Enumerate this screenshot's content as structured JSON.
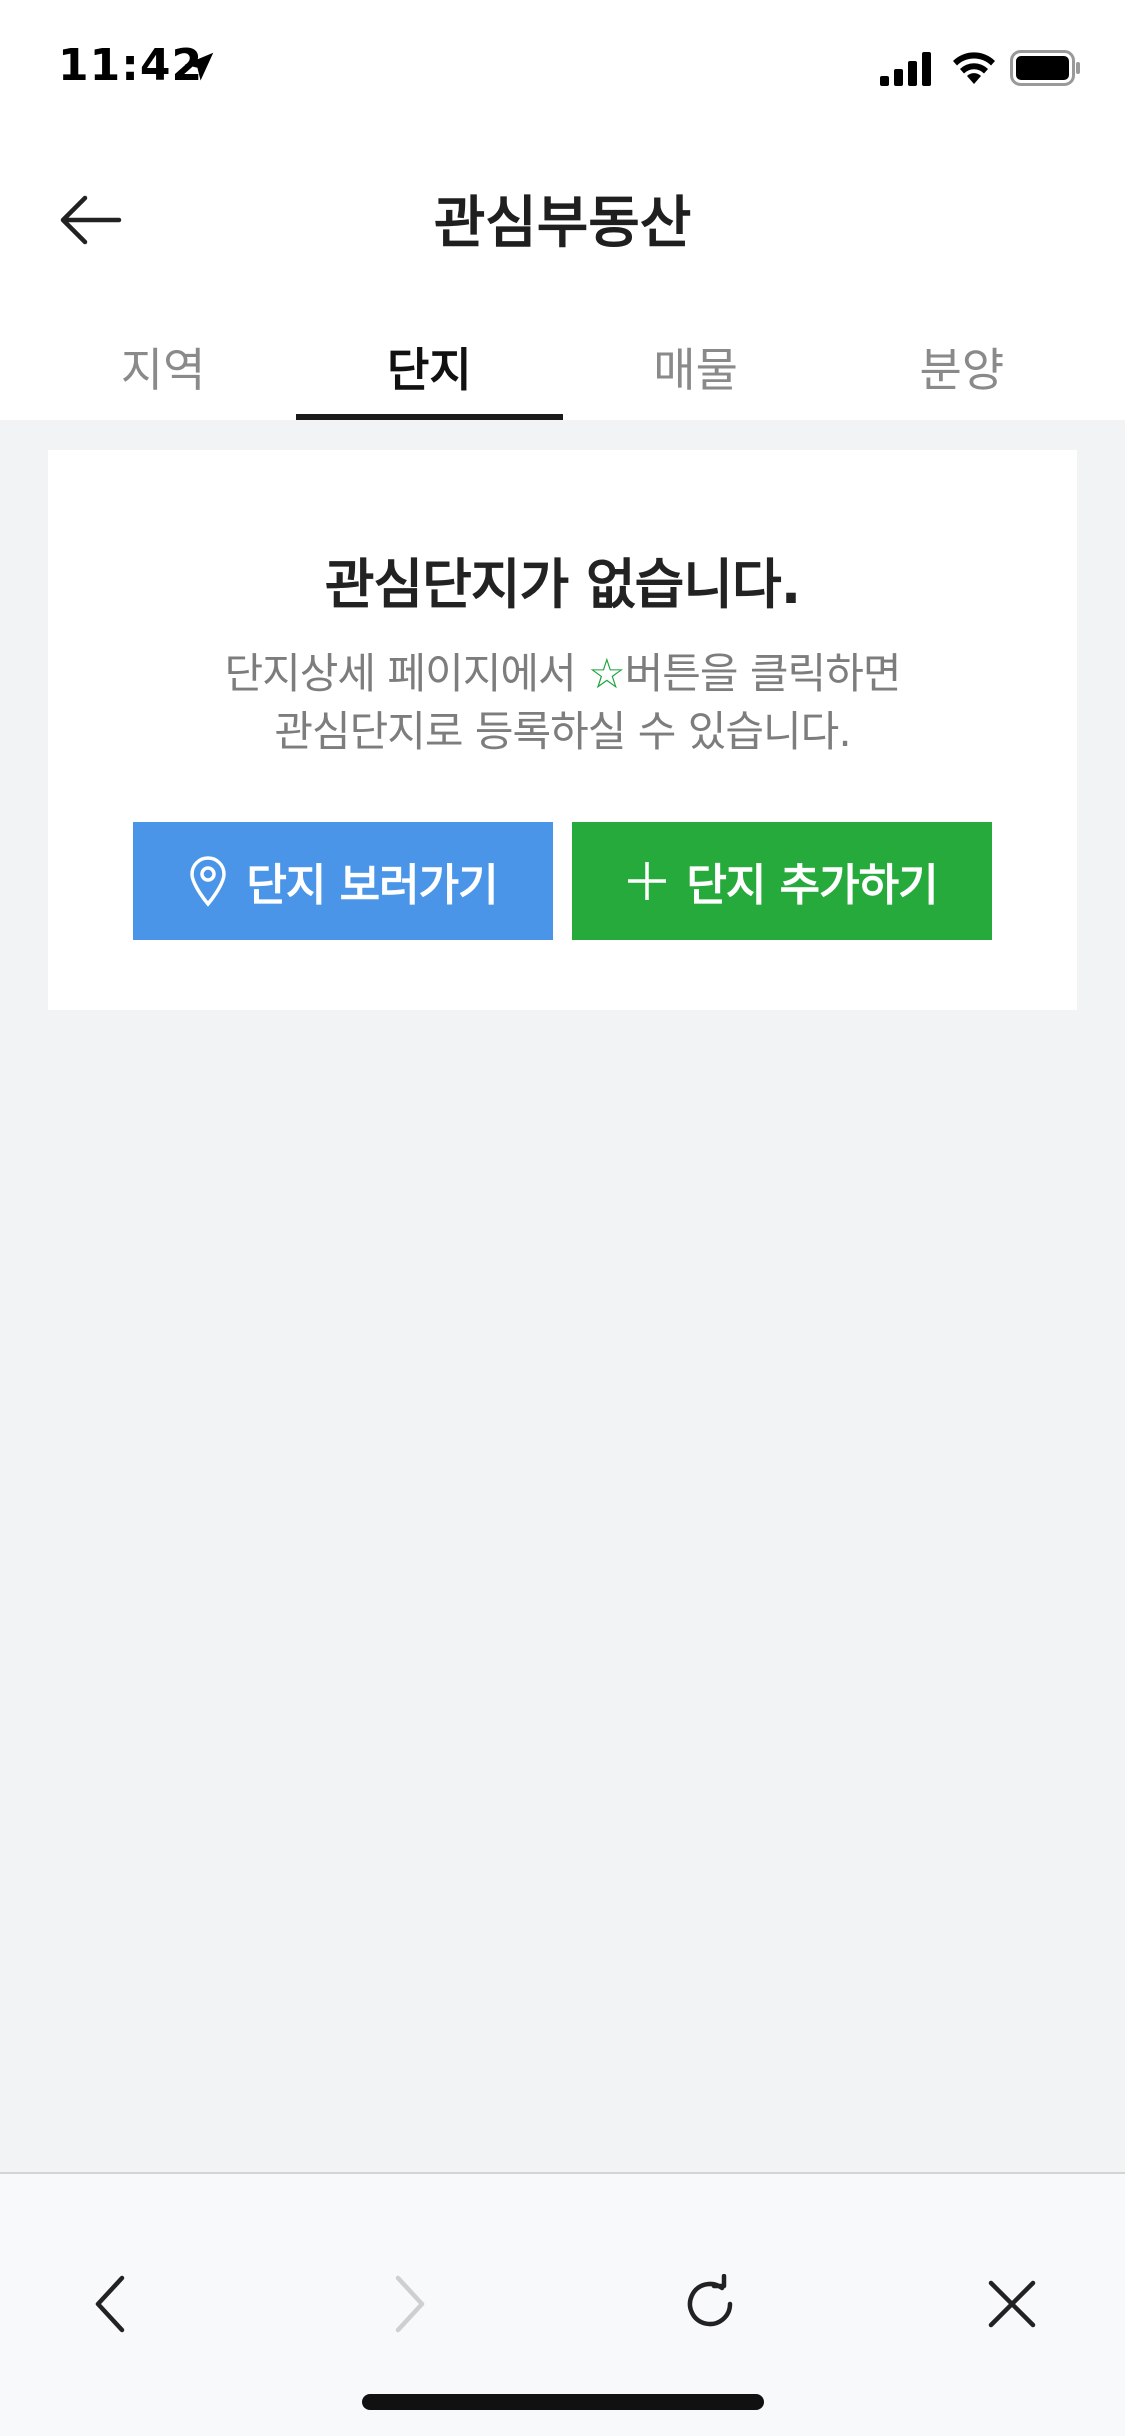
{
  "status_bar": {
    "time": "11:42",
    "icons": [
      "location-arrow-icon",
      "cellular-signal-icon",
      "wifi-icon",
      "battery-icon"
    ]
  },
  "header": {
    "title": "관심부동산",
    "back_icon": "arrow-left-icon"
  },
  "tabs": [
    {
      "label": "지역",
      "active": false
    },
    {
      "label": "단지",
      "active": true
    },
    {
      "label": "매물",
      "active": false
    },
    {
      "label": "분양",
      "active": false
    }
  ],
  "empty_state": {
    "title": "관심단지가 없습니다.",
    "desc_line1_before": "단지상세 페이지에서 ",
    "desc_star": "☆",
    "desc_line1_after": "버튼을 클릭하면",
    "desc_line2": "관심단지로 등록하실 수 있습니다.",
    "view_button_label": "단지 보러가기",
    "add_button_label": "단지 추가하기"
  },
  "toolbar": {
    "icons": [
      "chevron-left-icon",
      "chevron-right-icon",
      "reload-icon",
      "close-icon"
    ]
  },
  "colors": {
    "view_button": "#4a95e8",
    "add_button": "#27aa3c",
    "background": "#f2f3f5",
    "star": "#1fa33c"
  }
}
